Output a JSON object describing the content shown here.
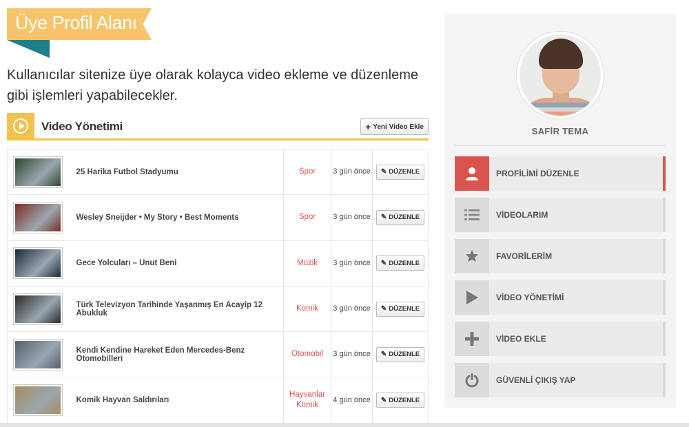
{
  "page": {
    "title": "Üye Profil Alanı",
    "intro": "Kullanıcılar sitenize üye olarak kolayca video ekleme ve düzenleme gibi işlemleri yapabilecekler."
  },
  "panel": {
    "title": "Video Yönetimi",
    "add_button": "Yeni Video Ekle",
    "edit_label": "DÜZENLE"
  },
  "videos": [
    {
      "title": "25 Harika Futbol Stadyumu",
      "category": "Spor",
      "time": "3 gün önce",
      "thumb_color": "#2f4a2e"
    },
    {
      "title": "Wesley Sneijder • My Story • Best Moments",
      "category": "Spor",
      "time": "3 gün önce",
      "thumb_color": "#7a2d22"
    },
    {
      "title": "Gece Yolcuları – Unut Beni",
      "category": "Müzik",
      "time": "3 gün önce",
      "thumb_color": "#1b2a3d"
    },
    {
      "title": "Türk Televizyon Tarihinde Yaşanmış En Acayip 12 Abukluk",
      "category": "Komik",
      "time": "3 gün önce",
      "thumb_color": "#2a2a2a"
    },
    {
      "title": "Kendi Kendine Hareket Eden Mercedes-Benz Otomobilleri",
      "category": "Otomobil",
      "time": "3 gün önce",
      "thumb_color": "#55606a"
    },
    {
      "title": "Komik Hayvan Saldırıları",
      "category": "Hayvanlar Komik",
      "time": "4 gün önce",
      "thumb_color": "#a88a5c"
    }
  ],
  "user": {
    "name": "SAFİR TEMA"
  },
  "menu": [
    {
      "label": "PROFİLİMİ DÜZENLE",
      "icon": "user-icon",
      "active": true
    },
    {
      "label": "VİDEOLARIM",
      "icon": "list-icon",
      "active": false
    },
    {
      "label": "FAVORİLERİM",
      "icon": "star-icon",
      "active": false
    },
    {
      "label": "VİDEO YÖNETİMİ",
      "icon": "play-icon",
      "active": false
    },
    {
      "label": "VİDEO EKLE",
      "icon": "plus-icon",
      "active": false
    },
    {
      "label": "GÜVENLİ ÇIKIŞ YAP",
      "icon": "power-icon",
      "active": false
    }
  ],
  "colors": {
    "accent_yellow": "#f2c14e",
    "ribbon": "#f7c46b",
    "ribbon_fold": "#1f7f8a",
    "category_red": "#d9534f",
    "active_red": "#d9534f"
  }
}
